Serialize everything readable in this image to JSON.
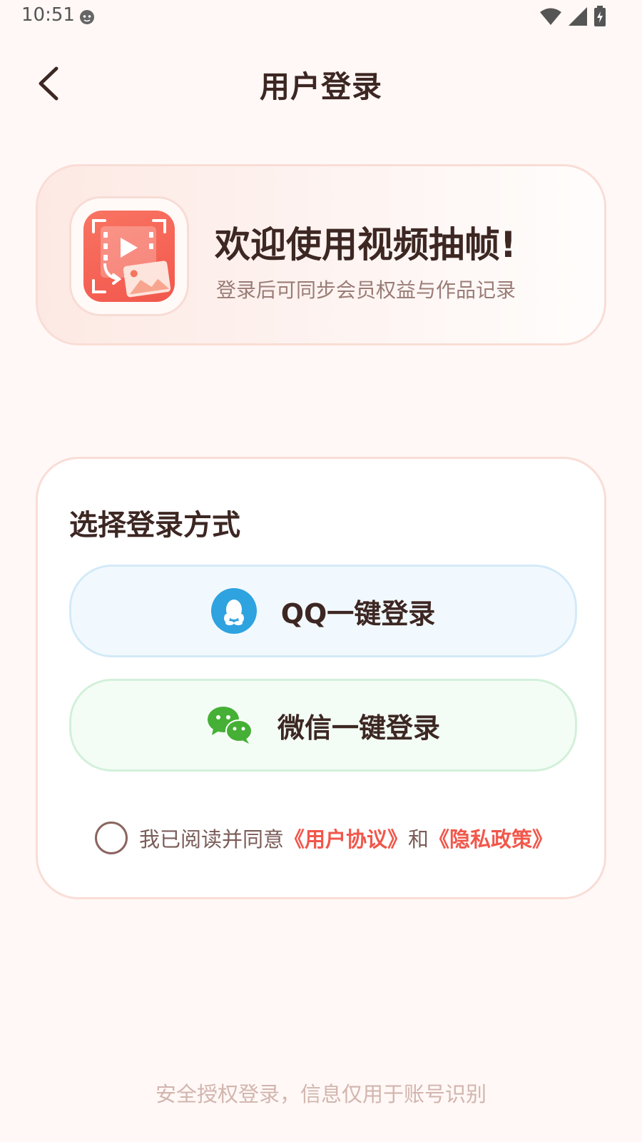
{
  "status_bar": {
    "time": "10:51"
  },
  "header": {
    "title": "用户登录"
  },
  "welcome": {
    "title": "欢迎使用视频抽帧!",
    "subtitle": "登录后可同步会员权益与作品记录"
  },
  "login": {
    "heading": "选择登录方式",
    "qq_label": "QQ一键登录",
    "wechat_label": "微信一键登录",
    "agree_prefix": "我已阅读并同意",
    "user_agreement": "《用户协议》",
    "and": "和",
    "privacy_policy": "《隐私政策》"
  },
  "footer": {
    "note": "安全授权登录，信息仅用于账号识别"
  },
  "colors": {
    "accent": "#f1574b",
    "qq": "#2ea3e0",
    "wechat": "#45b035",
    "background": "#fff8f6"
  }
}
